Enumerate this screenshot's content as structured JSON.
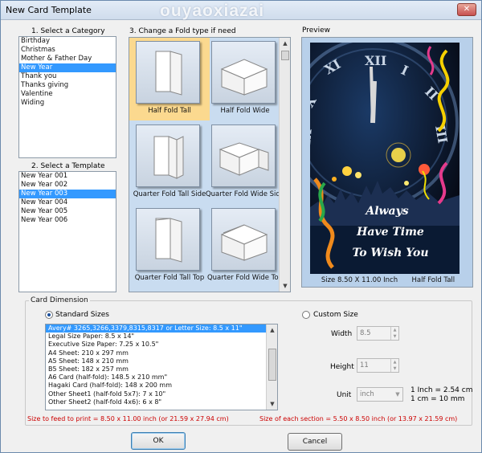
{
  "window": {
    "title": "New Card Template",
    "watermark": "ouyaoxiazai",
    "close_glyph": "✕"
  },
  "category": {
    "heading": "1. Select a Category",
    "items": [
      "Birthday",
      "Christmas",
      "Mother & Father Day",
      "New Year",
      "Thank you",
      "Thanks giving",
      "Valentine",
      "Widing"
    ],
    "selected_index": 3
  },
  "template": {
    "heading": "2. Select a Template",
    "items": [
      "New Year 001",
      "New Year 002",
      "New Year 003",
      "New Year 004",
      "New Year 005",
      "New Year 006"
    ],
    "selected_index": 2
  },
  "fold": {
    "heading": "3. Change a Fold type if need",
    "items": [
      {
        "label": "Half Fold Tall",
        "icon": "half-fold-tall-icon"
      },
      {
        "label": "Half Fold Wide",
        "icon": "half-fold-wide-icon"
      },
      {
        "label": "Quarter Fold Tall Side",
        "icon": "quarter-fold-tall-side-icon"
      },
      {
        "label": "Quarter Fold Wide Side",
        "icon": "quarter-fold-wide-side-icon"
      },
      {
        "label": "Quarter Fold Tall Top",
        "icon": "quarter-fold-tall-top-icon"
      },
      {
        "label": "Quarter Fold Wide Top",
        "icon": "quarter-fold-wide-top-icon"
      }
    ],
    "selected_index": 0
  },
  "preview": {
    "heading": "Preview",
    "card_text": [
      "Always",
      "Have Time",
      "To Wish You"
    ],
    "size_caption": "Size 8.50 X 11.00 Inch",
    "fold_caption": "Half Fold Tall"
  },
  "dimension": {
    "legend": "Card Dimension",
    "standard_label": "Standard Sizes",
    "custom_label": "Custom Size",
    "standard_selected": true,
    "sizes": [
      "Avery# 3265,3266,3379,8315,8317 or Letter Size: 8.5 x 11\"",
      "Legal Size Paper: 8.5 x 14\"",
      "Executive Size Paper: 7.25 x 10.5\"",
      "A4 Sheet: 210 x 297 mm",
      "A5 Sheet: 148 x 210 mm",
      "B5 Sheet: 182 x 257 mm",
      "A6 Card (half-fold): 148.5 x 210 mm\"",
      "Hagaki Card (half-fold): 148 x 200 mm",
      "Other Sheet1 (half-fold 5x7): 7 x 10\"",
      "Other Sheet2 (half-fold 4x6): 6 x 8\""
    ],
    "sizes_selected_index": 0,
    "width_label": "Width",
    "width_value": "8.5",
    "height_label": "Height",
    "height_value": "11",
    "unit_label": "Unit",
    "unit_value": "inch",
    "conversion_1": "1 Inch = 2.54 cm",
    "conversion_2": "1 cm = 10 mm"
  },
  "info": {
    "feed_text": "Size to feed to print = 8.50 x 11.00 inch (or  21.59 x 27.94 cm)",
    "section_text": "Size of each section = 5.50 x 8.50 inch (or  13.97 x 21.59 cm)"
  },
  "buttons": {
    "ok": "OK",
    "cancel": "Cancel"
  },
  "colors": {
    "selection": "#3399ff",
    "fold_selected": "#fbd98f",
    "fold_panel": "#c9dcf0",
    "info_red": "#cc0000"
  }
}
